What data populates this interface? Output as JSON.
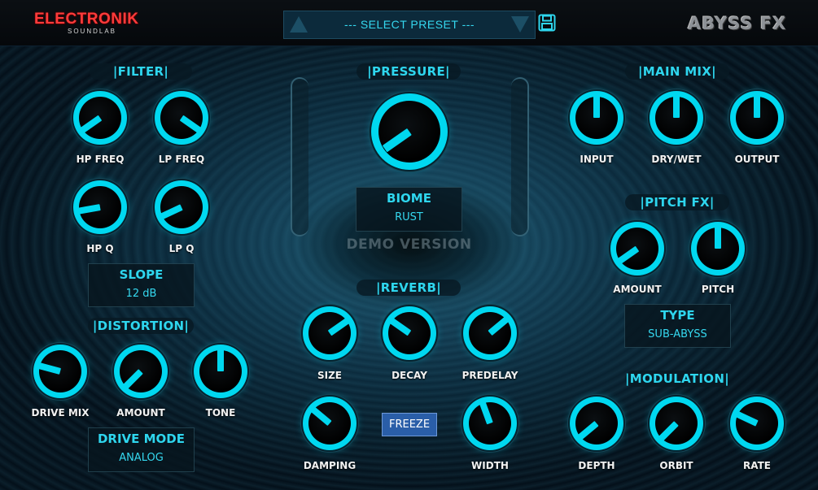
{
  "header": {
    "brand": "ELECTRONIK",
    "brand_sub": "SOUNDLAB",
    "preset_label": "--- SELECT PRESET ---",
    "product_name": "ABYSS FX"
  },
  "sections": {
    "filter": "|FILTER|",
    "pressure": "|PRESSURE|",
    "main_mix": "|MAIN MIX|",
    "pitch_fx": "|PITCH FX|",
    "distortion": "|DISTORTION|",
    "reverb": "|REVERB|",
    "modulation": "|MODULATION|"
  },
  "knobs": {
    "hp_freq": {
      "label": "HP FREQ"
    },
    "lp_freq": {
      "label": "LP FREQ"
    },
    "hp_q": {
      "label": "HP Q"
    },
    "lp_q": {
      "label": "LP Q"
    },
    "pressure": {
      "label": ""
    },
    "input": {
      "label": "INPUT"
    },
    "dry_wet": {
      "label": "DRY/WET"
    },
    "output": {
      "label": "OUTPUT"
    },
    "pitch_amount": {
      "label": "AMOUNT"
    },
    "pitch": {
      "label": "PITCH"
    },
    "drive_mix": {
      "label": "DRIVE MIX"
    },
    "dist_amount": {
      "label": "AMOUNT"
    },
    "tone": {
      "label": "TONE"
    },
    "size": {
      "label": "SIZE"
    },
    "decay": {
      "label": "DECAY"
    },
    "predelay": {
      "label": "PREDELAY"
    },
    "damping": {
      "label": "DAMPING"
    },
    "width": {
      "label": "WIDTH"
    },
    "depth": {
      "label": "DEPTH"
    },
    "orbit": {
      "label": "ORBIT"
    },
    "rate": {
      "label": "RATE"
    }
  },
  "selectors": {
    "slope": {
      "title": "SLOPE",
      "value": "12 dB"
    },
    "biome": {
      "title": "BIOME",
      "value": "RUST"
    },
    "type": {
      "title": "TYPE",
      "value": "SUB-ABYSS"
    },
    "drive_mode": {
      "title": "DRIVE MODE",
      "value": "ANALOG"
    }
  },
  "demo_text": "DEMO VERSION",
  "freeze_label": "FREEZE",
  "colors": {
    "accent": "#00d8f0",
    "accent_text": "#2ed6ee",
    "brand_red": "#ff3b3b",
    "freeze_button": "#2a5ea8"
  }
}
